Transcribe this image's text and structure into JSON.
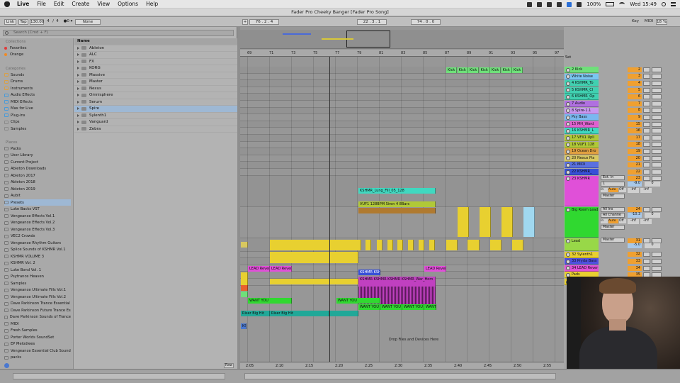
{
  "menubar": {
    "app_name": "Live",
    "items": [
      "File",
      "Edit",
      "Create",
      "View",
      "Options",
      "Help"
    ],
    "battery": "100%",
    "clock": "Wed 15:49"
  },
  "window": {
    "title": "Fader Pro Cheeky Banger  [Fader Pro Song]"
  },
  "control_bar": {
    "link": "Link",
    "tap": "Tap",
    "tempo": "130.00",
    "sig_num": "4",
    "sig_den": "4",
    "metro": "●0 ▾",
    "quant": "None",
    "arr_pos": "76 .  2 .  4",
    "loop_pos": "22 .  3 .  1",
    "loop_len": "74 .  0 .  0",
    "key": "Key",
    "midi": "MIDI",
    "cpu": "18 %"
  },
  "browser": {
    "search_placeholder": "Search (Cmd + F)",
    "collections_header": "Collections",
    "collections": [
      {
        "label": "Favorites",
        "color": "#e03a3a"
      },
      {
        "label": "Orange",
        "color": "#f08a24"
      }
    ],
    "categories_header": "Categories",
    "categories": [
      "Sounds",
      "Drums",
      "Instruments",
      "Audio Effects",
      "MIDI Effects",
      "Max for Live",
      "Plug-ins",
      "Clips",
      "Samples"
    ],
    "places_header": "Places",
    "places": [
      "Packs",
      "User Library",
      "Current Project",
      "Ableton Downloads",
      "Ableton 2017",
      "Ableton 2018",
      "Ableton 2019",
      "Aubit",
      "Presets",
      "Luke Backs VST",
      "Vengeance Effects Vol.1",
      "Vengeance Effects Vol.2",
      "Vengeance Effects Vol.3",
      "VEC2 Crowds",
      "Vengeance Rhythm Guitars",
      "Splice Sounds of KSHMR Vol.1",
      "KSHMR VOLUME 3",
      "KSHMR Vol. 2",
      "Luke Bond Vol. 1",
      "Psytrance Heaven",
      "Samples",
      "Vengeance Ultimate Fills Vol.1",
      "Vengeance Ultimate Fills Vol.2",
      "Dave Parkinson Trance Essential",
      "Dave Parkinson Future Trance Es",
      "Dave Parkinson Sounds of Trance",
      "MIDI",
      "Fresh Samples",
      "Porter Worlds SoundSet",
      "EP Melodiees",
      "Vengeance Essential Club Sound",
      "packs"
    ],
    "selected_place": "Presets",
    "list_header": "Name",
    "folders": [
      "Ableton",
      "ALC",
      "FX",
      "KORG",
      "Massive",
      "Master",
      "Nexus",
      "Omnisphere",
      "Serum",
      "Spire",
      "Sylenth1",
      "Vanguard",
      "Zebra"
    ],
    "selected_folder": "Spire",
    "raw": "Raw"
  },
  "arrangement": {
    "bar_labels": [
      "69",
      "71",
      "73",
      "75",
      "77",
      "79",
      "81",
      "83",
      "85",
      "87",
      "89",
      "91",
      "93",
      "95",
      "97"
    ],
    "time_labels": [
      "2:05",
      "2:10",
      "2:15",
      "2:20",
      "2:25",
      "2:30",
      "2:35",
      "2:40",
      "2:45",
      "2:50",
      "2:55"
    ],
    "drop_text": "Drop Files and Devices Here",
    "clips": {
      "kick": "Kick",
      "lung_fill": "KSHMR_Lung_Fill_05_128",
      "siren": "VUF1 128BPM Siren 4 8Bars",
      "war_horn_a": "KSHMR KSHM",
      "war_horn_b": "KSHMR KSHMR KSHMR KSHMR_War_Horn",
      "lead_rev": "LEAD Rever",
      "lead_revers": "LEAD Revers",
      "lead_revers2": "LEAD Revers",
      "want_you": "WANT YOU",
      "want_you_2019": "WANT YOU_2019-0",
      "riser": "Riser Big Hit",
      "riser2": "Riser Big Hit",
      "ks": "KS"
    }
  },
  "tracks": [
    {
      "name": "2 Kick",
      "color": "#6fe07a",
      "num": "2"
    },
    {
      "name": "White Noise",
      "color": "#7ac6f0",
      "num": "3"
    },
    {
      "name": "4 KSHMR_To",
      "color": "#40d0b0",
      "num": "4"
    },
    {
      "name": "5 KSHMR_Cl",
      "color": "#40d0b0",
      "num": "5"
    },
    {
      "name": "6 KSHMR_Op",
      "color": "#40d0b0",
      "num": "6"
    },
    {
      "name": "7 Audio",
      "color": "#b070e0",
      "num": "7"
    },
    {
      "name": "8 Spire-1.1",
      "color": "#c898f0",
      "num": "8"
    },
    {
      "name": "Psy Bass",
      "color": "#7ab8f0",
      "num": "9"
    },
    {
      "name": "15 MH_Ward",
      "color": "#e060d0",
      "num": "15"
    },
    {
      "name": "16 KSHMR_L",
      "color": "#40d8c0",
      "num": "16"
    },
    {
      "name": "17 VFX1 Upli",
      "color": "#b0c838",
      "num": "17"
    },
    {
      "name": "18 VUF1 128",
      "color": "#b0c838",
      "num": "18"
    },
    {
      "name": "19 Ocean Dro",
      "color": "#e0a040",
      "num": "19"
    },
    {
      "name": "20 Nexus Pia",
      "color": "#d8c860",
      "num": "20"
    },
    {
      "name": "21 MIDI",
      "color": "#5a70e0",
      "num": "21"
    },
    {
      "name": "22 KSHMR_",
      "color": "#3850d8",
      "num": "22"
    },
    {
      "name": "23 KSHMR",
      "color": "#e050d8",
      "num": "23"
    },
    {
      "name": "Big Room Lead",
      "color": "#30d830",
      "num": "24"
    },
    {
      "name": "Lead",
      "color": "#98d848",
      "num": "31"
    },
    {
      "name": "32 Sylenth1",
      "color": "#e8d030",
      "num": "32"
    },
    {
      "name": "33 Pryda Bass",
      "color": "#5050e0",
      "num": "33"
    },
    {
      "name": "34 LEAD Rever",
      "color": "#e050d8",
      "num": "34"
    },
    {
      "name": "Pads",
      "color": "#e8d030",
      "num": "35"
    },
    {
      "name": "40 Nexus",
      "color": "#e8d030",
      "num": "40"
    }
  ],
  "track_io": {
    "ext_in": "Ext. In",
    "all_ins": "All Ins",
    "all_channels": "All Channe",
    "master": "Master",
    "in": "In",
    "auto": "Auto",
    "off": "Off",
    "vol_23": "-9.0",
    "vol_24": "-10.3",
    "vol_31": "-5.0",
    "inf": "-inf",
    "zero": "0",
    "set": "Set"
  },
  "colors": {
    "accent_orange": "#f0a030",
    "transport_green": "#3cc03c",
    "selection_blue": "#9eb8d4"
  },
  "icons": [
    "apple-icon",
    "search-icon",
    "play-icon",
    "stop-icon",
    "record-icon",
    "folder-icon",
    "power-icon",
    "wifi-icon",
    "battery-icon"
  ]
}
